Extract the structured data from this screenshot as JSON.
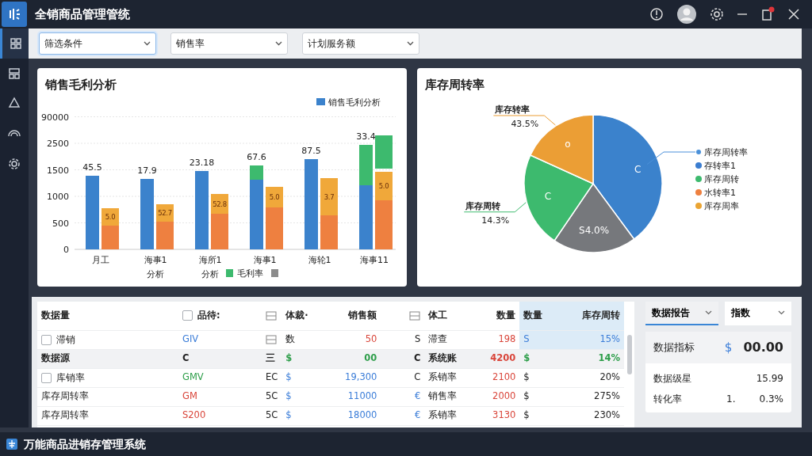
{
  "window": {
    "title": "全销商品管理管统"
  },
  "sidebar": {
    "items": [
      {
        "selected": true
      },
      {
        "selected": false
      },
      {
        "selected": false
      },
      {
        "selected": false
      },
      {
        "selected": false
      }
    ]
  },
  "filters": [
    {
      "value": "筛选条件",
      "focused": true
    },
    {
      "value": "销售率",
      "focused": false
    },
    {
      "value": "计划服务额",
      "focused": false
    }
  ],
  "sales_chart": {
    "title": "销售毛利分析",
    "top_legend": {
      "label": "销售毛利分析",
      "color": "#3b82cc"
    },
    "axis_labels": [
      "90000",
      "2500",
      "1500",
      "1000",
      "500",
      "0"
    ],
    "categories": [
      {
        "label": "月工"
      },
      {
        "label": "海事1",
        "note": "分析"
      },
      {
        "label": "海所1",
        "note": "分析"
      },
      {
        "label": "海事1"
      },
      {
        "label": "海轮1"
      },
      {
        "label": "海事11"
      }
    ],
    "bar_labels": [
      "45.5",
      "17.9",
      "23.18",
      "67.6",
      "87.5",
      "33.4"
    ],
    "inner_labels": [
      "5.0",
      "52.7",
      "52.8",
      "5.0",
      "3.7",
      "5.0"
    ],
    "bottom_legend": [
      {
        "label": "毛利率",
        "color": "#3dba6e"
      },
      {
        "color": "#8c8c8c"
      }
    ]
  },
  "turnover_chart": {
    "title": "库存周转率",
    "slice_labels": [
      "C",
      "S4.0%",
      "C",
      "o"
    ],
    "callouts": [
      {
        "label": "库存转率",
        "value": "43.5%"
      },
      {
        "label": "库存周转",
        "value": "14.3%"
      }
    ],
    "legend": [
      {
        "label": "库存周转率",
        "color": "#4a90d9",
        "kind": "lead"
      },
      {
        "label": "存转率1",
        "color": "#3b7dd0",
        "kind": "item"
      },
      {
        "label": "库存周转",
        "color": "#3dba6e",
        "kind": "item"
      },
      {
        "label": "水转率1",
        "color": "#ee8040",
        "kind": "item"
      },
      {
        "label": "库存周率",
        "color": "#eaa433",
        "kind": "item"
      }
    ]
  },
  "table": {
    "columns": [
      {
        "text": "数据量"
      },
      {
        "text": "品待:",
        "checked": false
      },
      {
        "kind": "icon"
      },
      {
        "text": "体裁·"
      },
      {
        "text": "销售额"
      },
      {
        "kind": "icon"
      },
      {
        "text": "体工"
      },
      {
        "text": "数量"
      },
      {
        "text": "数量",
        "highlight": true
      },
      {
        "text": "库存周转",
        "highlight": true
      }
    ],
    "rows": [
      {
        "kind": "item",
        "checked": false,
        "cells": [
          {
            "text": "滞销"
          },
          {
            "text": "GIV",
            "color": "#3b7dd8"
          },
          {
            "kind": "icon"
          },
          {
            "text": "数"
          },
          {
            "text": "50",
            "color": "#d9453a"
          },
          {
            "text": "S"
          },
          {
            "text": "滞查"
          },
          {
            "text": "198",
            "color": "#d9453a"
          },
          {
            "text": "S",
            "color": "#3b7dd8",
            "highlight": true
          },
          {
            "text": "15%",
            "color": "#3b7dd8",
            "highlight": true
          }
        ]
      },
      {
        "kind": "group",
        "cells": [
          {
            "text": "数据源"
          },
          {
            "text": "C"
          },
          {
            "text": "三"
          },
          {
            "text": "$",
            "color": "#2e9e4a"
          },
          {
            "text": "00",
            "color": "#2e9e4a"
          },
          {
            "text": "C"
          },
          {
            "text": "系统账"
          },
          {
            "text": "4200",
            "color": "#d9453a"
          },
          {
            "text": "$",
            "color": "#2e9e4a"
          },
          {
            "text": "14%",
            "color": "#2e9e4a"
          }
        ]
      },
      {
        "kind": "item",
        "checked": false,
        "cells": [
          {
            "text": "库销率"
          },
          {
            "text": "GMV",
            "color": "#2e9e4a"
          },
          {
            "text": "EC"
          },
          {
            "text": "$",
            "color": "#3b7dd8"
          },
          {
            "text": "19,300",
            "color": "#3b7dd8"
          },
          {
            "text": "C"
          },
          {
            "text": "系销率"
          },
          {
            "text": "2100",
            "color": "#d9453a"
          },
          {
            "text": "$"
          },
          {
            "text": "20%"
          }
        ]
      },
      {
        "kind": "item",
        "cells": [
          {
            "text": "库存周转率"
          },
          {
            "text": "GM",
            "color": "#d9453a"
          },
          {
            "text": "5C"
          },
          {
            "text": "$",
            "color": "#3b7dd8"
          },
          {
            "text": "11000",
            "color": "#3b7dd8"
          },
          {
            "text": "€",
            "color": "#3b7dd8"
          },
          {
            "text": "销售率"
          },
          {
            "text": "2000",
            "color": "#d9453a"
          },
          {
            "text": "$"
          },
          {
            "text": "275%"
          }
        ]
      },
      {
        "kind": "item",
        "cells": [
          {
            "text": "库存周转率"
          },
          {
            "text": "S200",
            "color": "#d9453a"
          },
          {
            "text": "5C"
          },
          {
            "text": "$",
            "color": "#3b7dd8"
          },
          {
            "text": "18000",
            "color": "#3b7dd8"
          },
          {
            "text": "€",
            "color": "#3b7dd8"
          },
          {
            "text": "系销率"
          },
          {
            "text": "3130",
            "color": "#d9453a"
          },
          {
            "text": "$"
          },
          {
            "text": "230%"
          }
        ]
      }
    ]
  },
  "summary": {
    "tabs": [
      {
        "label": "数据报告",
        "selected": true
      },
      {
        "label": "指数",
        "selected": false
      }
    ],
    "stats": [
      {
        "kind": "headline",
        "label": "数据指标",
        "prefix": "$",
        "value": "00.00"
      },
      {
        "kind": "plain",
        "label": "数据级星",
        "value": "15.99"
      },
      {
        "kind": "plain",
        "label": "转化率",
        "prefix": "1.",
        "value": "0.3%"
      }
    ]
  },
  "status_bar": {
    "title": "万能商品进销存管理系统"
  }
}
